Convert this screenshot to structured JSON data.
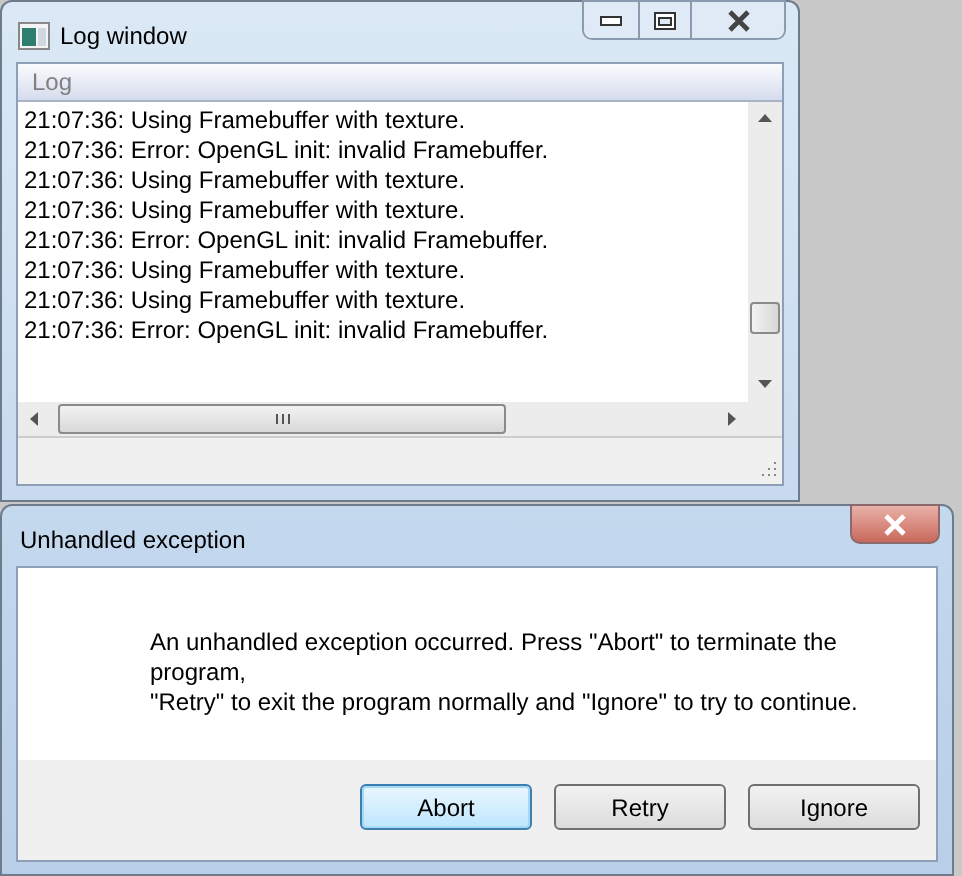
{
  "log_window": {
    "title": "Log window",
    "panel_title": "Log",
    "lines": [
      "21:07:36: Using Framebuffer with texture.",
      "21:07:36: Error: OpenGL init: invalid Framebuffer.",
      "21:07:36: Using Framebuffer with texture.",
      "21:07:36: Using Framebuffer with texture.",
      "21:07:36: Error: OpenGL init: invalid Framebuffer.",
      "21:07:36: Using Framebuffer with texture.",
      "21:07:36: Using Framebuffer with texture.",
      "21:07:36: Error: OpenGL init: invalid Framebuffer."
    ]
  },
  "dialog": {
    "title": "Unhandled exception",
    "message": "An unhandled exception occurred. Press \"Abort\" to terminate the program,\n\"Retry\" to exit the program normally and \"Ignore\" to try to continue.",
    "buttons": [
      {
        "label": "Abort",
        "focused": true
      },
      {
        "label": "Retry",
        "focused": false
      },
      {
        "label": "Ignore",
        "focused": false
      }
    ]
  }
}
